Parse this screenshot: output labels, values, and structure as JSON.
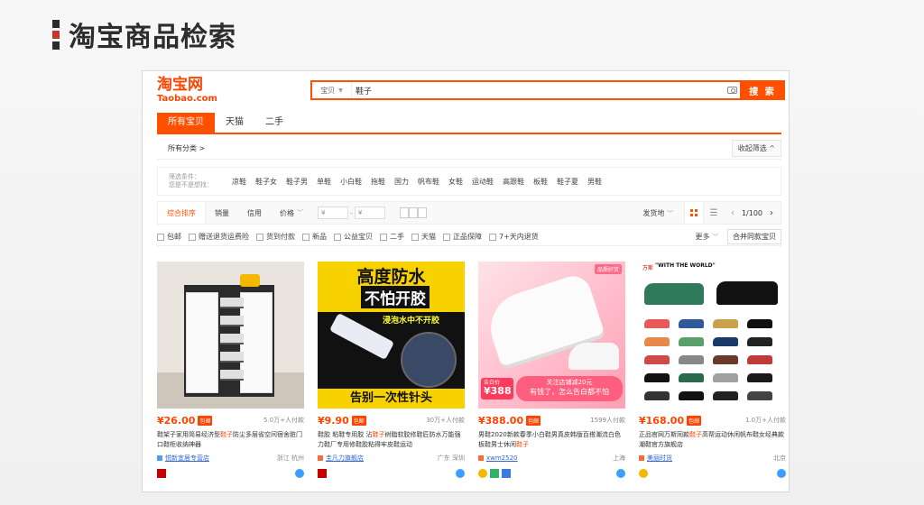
{
  "slide_title": "淘宝商品检索",
  "logo": {
    "cn": "淘宝网",
    "en": "Taobao.com"
  },
  "search": {
    "scope": "宝贝",
    "query": "鞋子",
    "button": "搜 索"
  },
  "tabs": [
    "所有宝贝",
    "天猫",
    "二手"
  ],
  "crumb": "所有分类 >",
  "collapse": "收起筛选 ^",
  "filter_label": [
    "筛选条件：",
    "您是不是想找："
  ],
  "filter_chips": [
    "凉鞋",
    "鞋子女",
    "鞋子男",
    "单鞋",
    "小白鞋",
    "拖鞋",
    "国力",
    "帆布鞋",
    "女鞋",
    "运动鞋",
    "高跟鞋",
    "板鞋",
    "鞋子夏",
    "男鞋"
  ],
  "sort": {
    "items": [
      "综合排序",
      "销量",
      "信用",
      "价格"
    ],
    "price_min_placeholder": "¥",
    "price_max_placeholder": "¥"
  },
  "ship_from": "发货地",
  "pager": {
    "page": "1/100"
  },
  "options": [
    "包邮",
    "赠送退货运费险",
    "货到付款",
    "新品",
    "公益宝贝",
    "二手",
    "天猫",
    "正品保障",
    "7+天内退货"
  ],
  "more": "更多",
  "merge": "合并同款宝贝",
  "products": [
    {
      "price": "¥26.00",
      "tag": "包邮",
      "sold": "5.0万+人付款",
      "title_pre": "鞋架子家用简易经济型",
      "title_hl": "鞋子",
      "title_post": "防尘多层省空间宿舍脏门口鞋柜收纳神器",
      "shop": "悦新宜居专营店",
      "loc": "浙江 杭州"
    },
    {
      "price": "¥9.90",
      "tag": "包邮",
      "sold": "30万+人付款",
      "title_pre": "鞋胶 粘鞋专用胶 沾",
      "title_hl": "鞋子",
      "title_post": "树脂软胶修鞋匠防水万能强力鞋厂专用修鞋胶粘得牢皮鞋运动",
      "shop": "圭凡力旗舰店",
      "loc": "广东 深圳"
    },
    {
      "price": "¥388.00",
      "tag": "包邮",
      "sold": "1599人付款",
      "title_pre": "男鞋2020新款春季小白鞋男真皮韩版百搭潮流白色板鞋男士休闲",
      "title_hl": "鞋子",
      "title_post": "",
      "shop": "xwm2520",
      "loc": "上海"
    },
    {
      "price": "¥168.00",
      "tag": "包邮",
      "sold": "1.0万+人付款",
      "title_pre": "正品官网万斯同款",
      "title_hl": "鞋子",
      "title_post": "高帮运动休闲帆布鞋女经典款潮鞋官方旗舰店",
      "shop": "美丽时货",
      "loc": "北京"
    }
  ],
  "product_images": {
    "p2_line1": "高度防水",
    "p2_line2": "不怕开胶",
    "p2_line3": "浸泡水中不开胶",
    "p2_bottom": "告别一次性针头",
    "p3_corner": "品质好货",
    "p3_badge_a": "告白价",
    "p3_badge_b": "¥388",
    "p3_promo_a": "关注店铺减20元",
    "p3_promo_b": "有钱了，怎么告白都不怕",
    "p4_brand": "万斯",
    "p4_wtw": "\"WITH THE WORLD\""
  }
}
